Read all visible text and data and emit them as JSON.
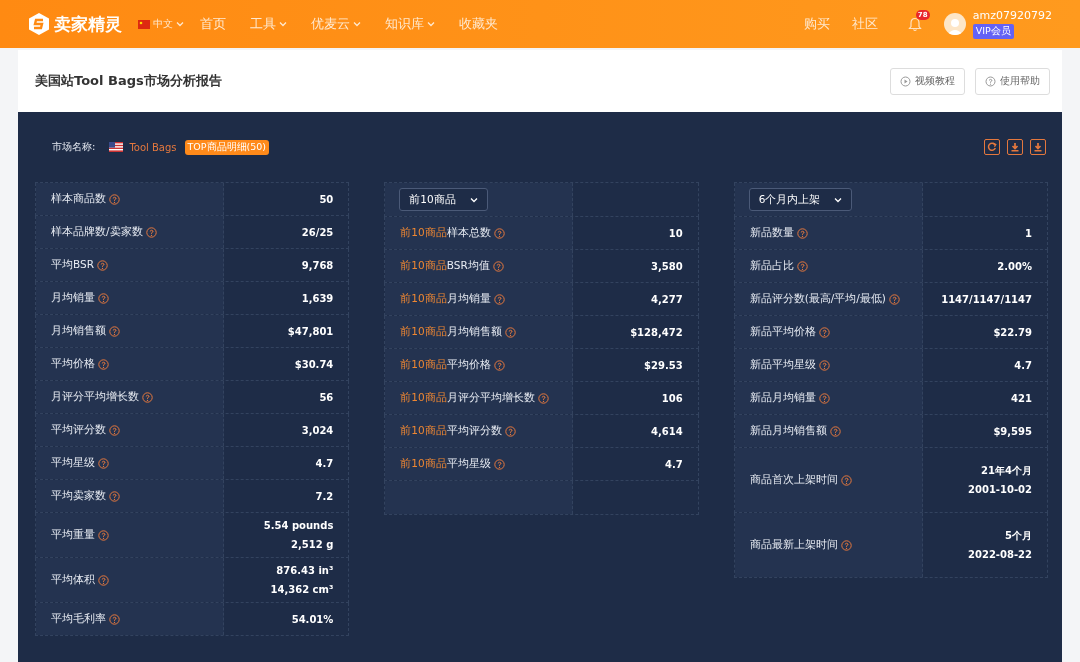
{
  "header": {
    "brand": "卖家精灵",
    "language": "中文",
    "nav": [
      {
        "label": "首页",
        "dropdown": false
      },
      {
        "label": "工具",
        "dropdown": true
      },
      {
        "label": "优麦云",
        "dropdown": true
      },
      {
        "label": "知识库",
        "dropdown": true
      },
      {
        "label": "收藏夹",
        "dropdown": false
      }
    ],
    "right_links": [
      "购买",
      "社区"
    ],
    "notification_count": "78",
    "username": "amz07920792",
    "member_badge": "VIP会员"
  },
  "page": {
    "title": "美国站Tool Bags市场分析报告",
    "buttons": [
      "视频教程",
      "使用帮助"
    ]
  },
  "report": {
    "market_label": "市场名称:",
    "market_name": "Tool Bags",
    "top_badge": "TOP商品明细(50)",
    "columns": [
      {
        "rows": [
          {
            "label": "样本商品数",
            "values": [
              "50"
            ]
          },
          {
            "label": "样本品牌数/卖家数",
            "values": [
              "26/25"
            ]
          },
          {
            "label": "平均BSR",
            "values": [
              "9,768"
            ]
          },
          {
            "label": "月均销量",
            "values": [
              "1,639"
            ]
          },
          {
            "label": "月均销售额",
            "values": [
              "$47,801"
            ]
          },
          {
            "label": "平均价格",
            "values": [
              "$30.74"
            ]
          },
          {
            "label": "月评分平均增长数",
            "values": [
              "56"
            ]
          },
          {
            "label": "平均评分数",
            "values": [
              "3,024"
            ]
          },
          {
            "label": "平均星级",
            "values": [
              "4.7"
            ]
          },
          {
            "label": "平均卖家数",
            "values": [
              "7.2"
            ]
          },
          {
            "label": "平均重量",
            "values": [
              "5.54 pounds",
              "2,512 g"
            ]
          },
          {
            "label": "平均体积",
            "values": [
              "876.43 in³",
              "14,362 cm³"
            ]
          },
          {
            "label": "平均毛利率",
            "values": [
              "54.01%"
            ]
          }
        ]
      },
      {
        "select": "前10商品",
        "rows": [
          {
            "prefix": "前10商品",
            "label": "样本总数",
            "values": [
              "10"
            ]
          },
          {
            "prefix": "前10商品",
            "label": "BSR均值",
            "values": [
              "3,580"
            ]
          },
          {
            "prefix": "前10商品",
            "label": "月均销量",
            "values": [
              "4,277"
            ]
          },
          {
            "prefix": "前10商品",
            "label": "月均销售额",
            "values": [
              "$128,472"
            ]
          },
          {
            "prefix": "前10商品",
            "label": "平均价格",
            "values": [
              "$29.53"
            ]
          },
          {
            "prefix": "前10商品",
            "label": "月评分平均增长数",
            "values": [
              "106"
            ]
          },
          {
            "prefix": "前10商品",
            "label": "平均评分数",
            "values": [
              "4,614"
            ]
          },
          {
            "prefix": "前10商品",
            "label": "平均星级",
            "values": [
              "4.7"
            ]
          },
          {
            "kind": "empty"
          }
        ]
      },
      {
        "select": "6个月内上架",
        "rows": [
          {
            "label": "新品数量",
            "values": [
              "1"
            ]
          },
          {
            "label": "新品占比",
            "values": [
              "2.00%"
            ]
          },
          {
            "label": "新品评分数(最高/平均/最低)",
            "values": [
              "1147/1147/1147"
            ]
          },
          {
            "label": "新品平均价格",
            "values": [
              "$22.79"
            ]
          },
          {
            "label": "新品平均星级",
            "values": [
              "4.7"
            ]
          },
          {
            "label": "新品月均销量",
            "values": [
              "421"
            ]
          },
          {
            "label": "新品月均销售额",
            "values": [
              "$9,595"
            ]
          },
          {
            "label": "商品首次上架时间",
            "values": [
              "21年4个月",
              "2001-10-02"
            ],
            "tall": true
          },
          {
            "label": "商品最新上架时间",
            "values": [
              "5个月",
              "2022-08-22"
            ],
            "tall": true
          }
        ]
      }
    ]
  }
}
